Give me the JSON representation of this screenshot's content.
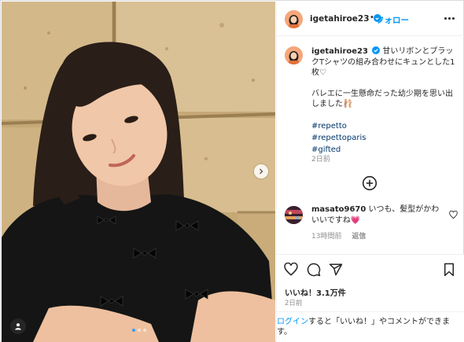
{
  "post": {
    "username": "igetahiroe23",
    "follow_label": "フォロー",
    "separator": "•",
    "caption": {
      "username": "igetahiroe23",
      "line1": "甘いリボンとブラックTシャツの組み合わせにキュンとした1枚♡",
      "line2": "バレエに一生懸命だった幼少期を思い出しました🩰",
      "hashtags": [
        "#repetto",
        "#repettoparis",
        "#gifted"
      ],
      "time": "2日前"
    },
    "comments": [
      {
        "username": "masato9670",
        "text": "いつも、髪型がかわいいですね💗",
        "time": "13時間前",
        "reply_label": "返信"
      }
    ],
    "likes_text": "いいね！3.1万件",
    "date": "2日前",
    "login_prompt": {
      "link": "ログイン",
      "text": "すると「いいね！」やコメントができます。"
    },
    "carousel": {
      "total": 3,
      "active": 0
    }
  },
  "icons": {
    "verified": "verified-badge-icon",
    "more": "more-options-icon",
    "load_more": "plus-circle-icon",
    "like": "heart-icon",
    "comment": "comment-icon",
    "share": "share-icon",
    "save": "bookmark-icon",
    "next": "chevron-right-icon",
    "tag": "user-tag-icon"
  },
  "colors": {
    "accent": "#0095f6",
    "hashtag": "#00376b",
    "muted": "#8e8e8e",
    "text": "#262626"
  }
}
